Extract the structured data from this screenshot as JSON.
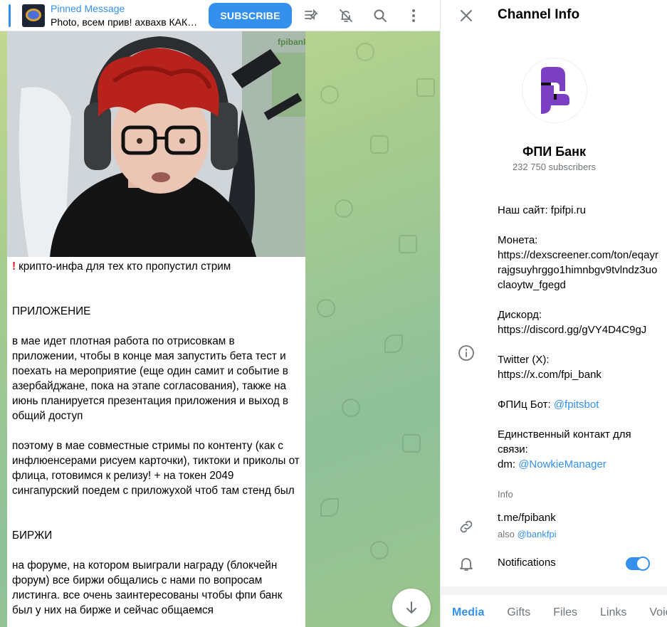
{
  "pinned": {
    "title": "Pinned Message",
    "text": "Photo, всем прив! ахвахв КАК Я РАД ВАС ВИДЕТЬ",
    "subscribe_label": "SUBSCRIBE"
  },
  "icons": {
    "pin_list": "pin-list-icon",
    "mute": "bell-off-icon",
    "search": "search-icon",
    "more": "more-vertical-icon",
    "scroll": "arrow-down-icon",
    "close": "close-icon",
    "info": "info-icon",
    "link": "link-icon",
    "bell": "bell-icon"
  },
  "photo": {
    "watermark": "fpibank"
  },
  "message": {
    "line_crypto": "крипто-инфа для тех кто пропустил стрим",
    "heading_app": "ПРИЛОЖЕНИЕ",
    "para_app": "в мае идет плотная работа по отрисовкам в приложении, чтобы в конце мая запустить бета тест и поехать на мероприятие (еще один самит и событие в азербайджане, пока на этапе согласования), также на июнь планируется презентация приложения и выход в общий доступ",
    "para_streams": "поэтому в мае совместные стримы по контенту (как с инфлюенсерами рисуем карточки), тиктоки и приколы от флица, готовимся к релизу! + на токен 2049 сингапурский поедем с приложухой чтоб там стенд был",
    "heading_exchanges": "БИРЖИ",
    "para_exchanges": "на форуме, на котором выиграли награду (блокчейн форум) все биржи общались с нами по вопросам листинга. все очень заинтересованы чтобы фпи банк был у них на бирже и сейчас общаемся"
  },
  "panel": {
    "title": "Channel Info",
    "channel_name": "ФПИ Банк",
    "subscribers": "232 750 subscribers",
    "site_label": "Наш сайт: fpifpi.ru",
    "coin_label": "Монета:",
    "coin_url": "https://dexscreener.com/ton/eqayrrajgsuyhrggo1himnbgv9tvlndz3uoclaoytw_fgegd",
    "discord_label": "Дискорд:",
    "discord_url": "https://discord.gg/gVY4D4C9gJ",
    "twitter_label": "Twitter (X):",
    "twitter_url": "https://x.com/fpi_bank",
    "bot_label": "ФПИц Бот:",
    "bot_handle": "@fpitsbot",
    "contact_label": "Единственный контакт для связи:",
    "dm_label": "dm:",
    "dm_handle": "@NowkieManager",
    "info_caption": "Info",
    "link": "t.me/fpibank",
    "also_label": "also",
    "also_handle": "@bankfpi",
    "notifications_label": "Notifications",
    "notifications_on": true
  },
  "tabs": [
    "Media",
    "Gifts",
    "Files",
    "Links",
    "Voice"
  ],
  "active_tab": "Media",
  "colors": {
    "accent": "#3390ec",
    "avatar_purple": "#7b3fc4",
    "hair": "#b8221c",
    "warning": "#d71920"
  }
}
